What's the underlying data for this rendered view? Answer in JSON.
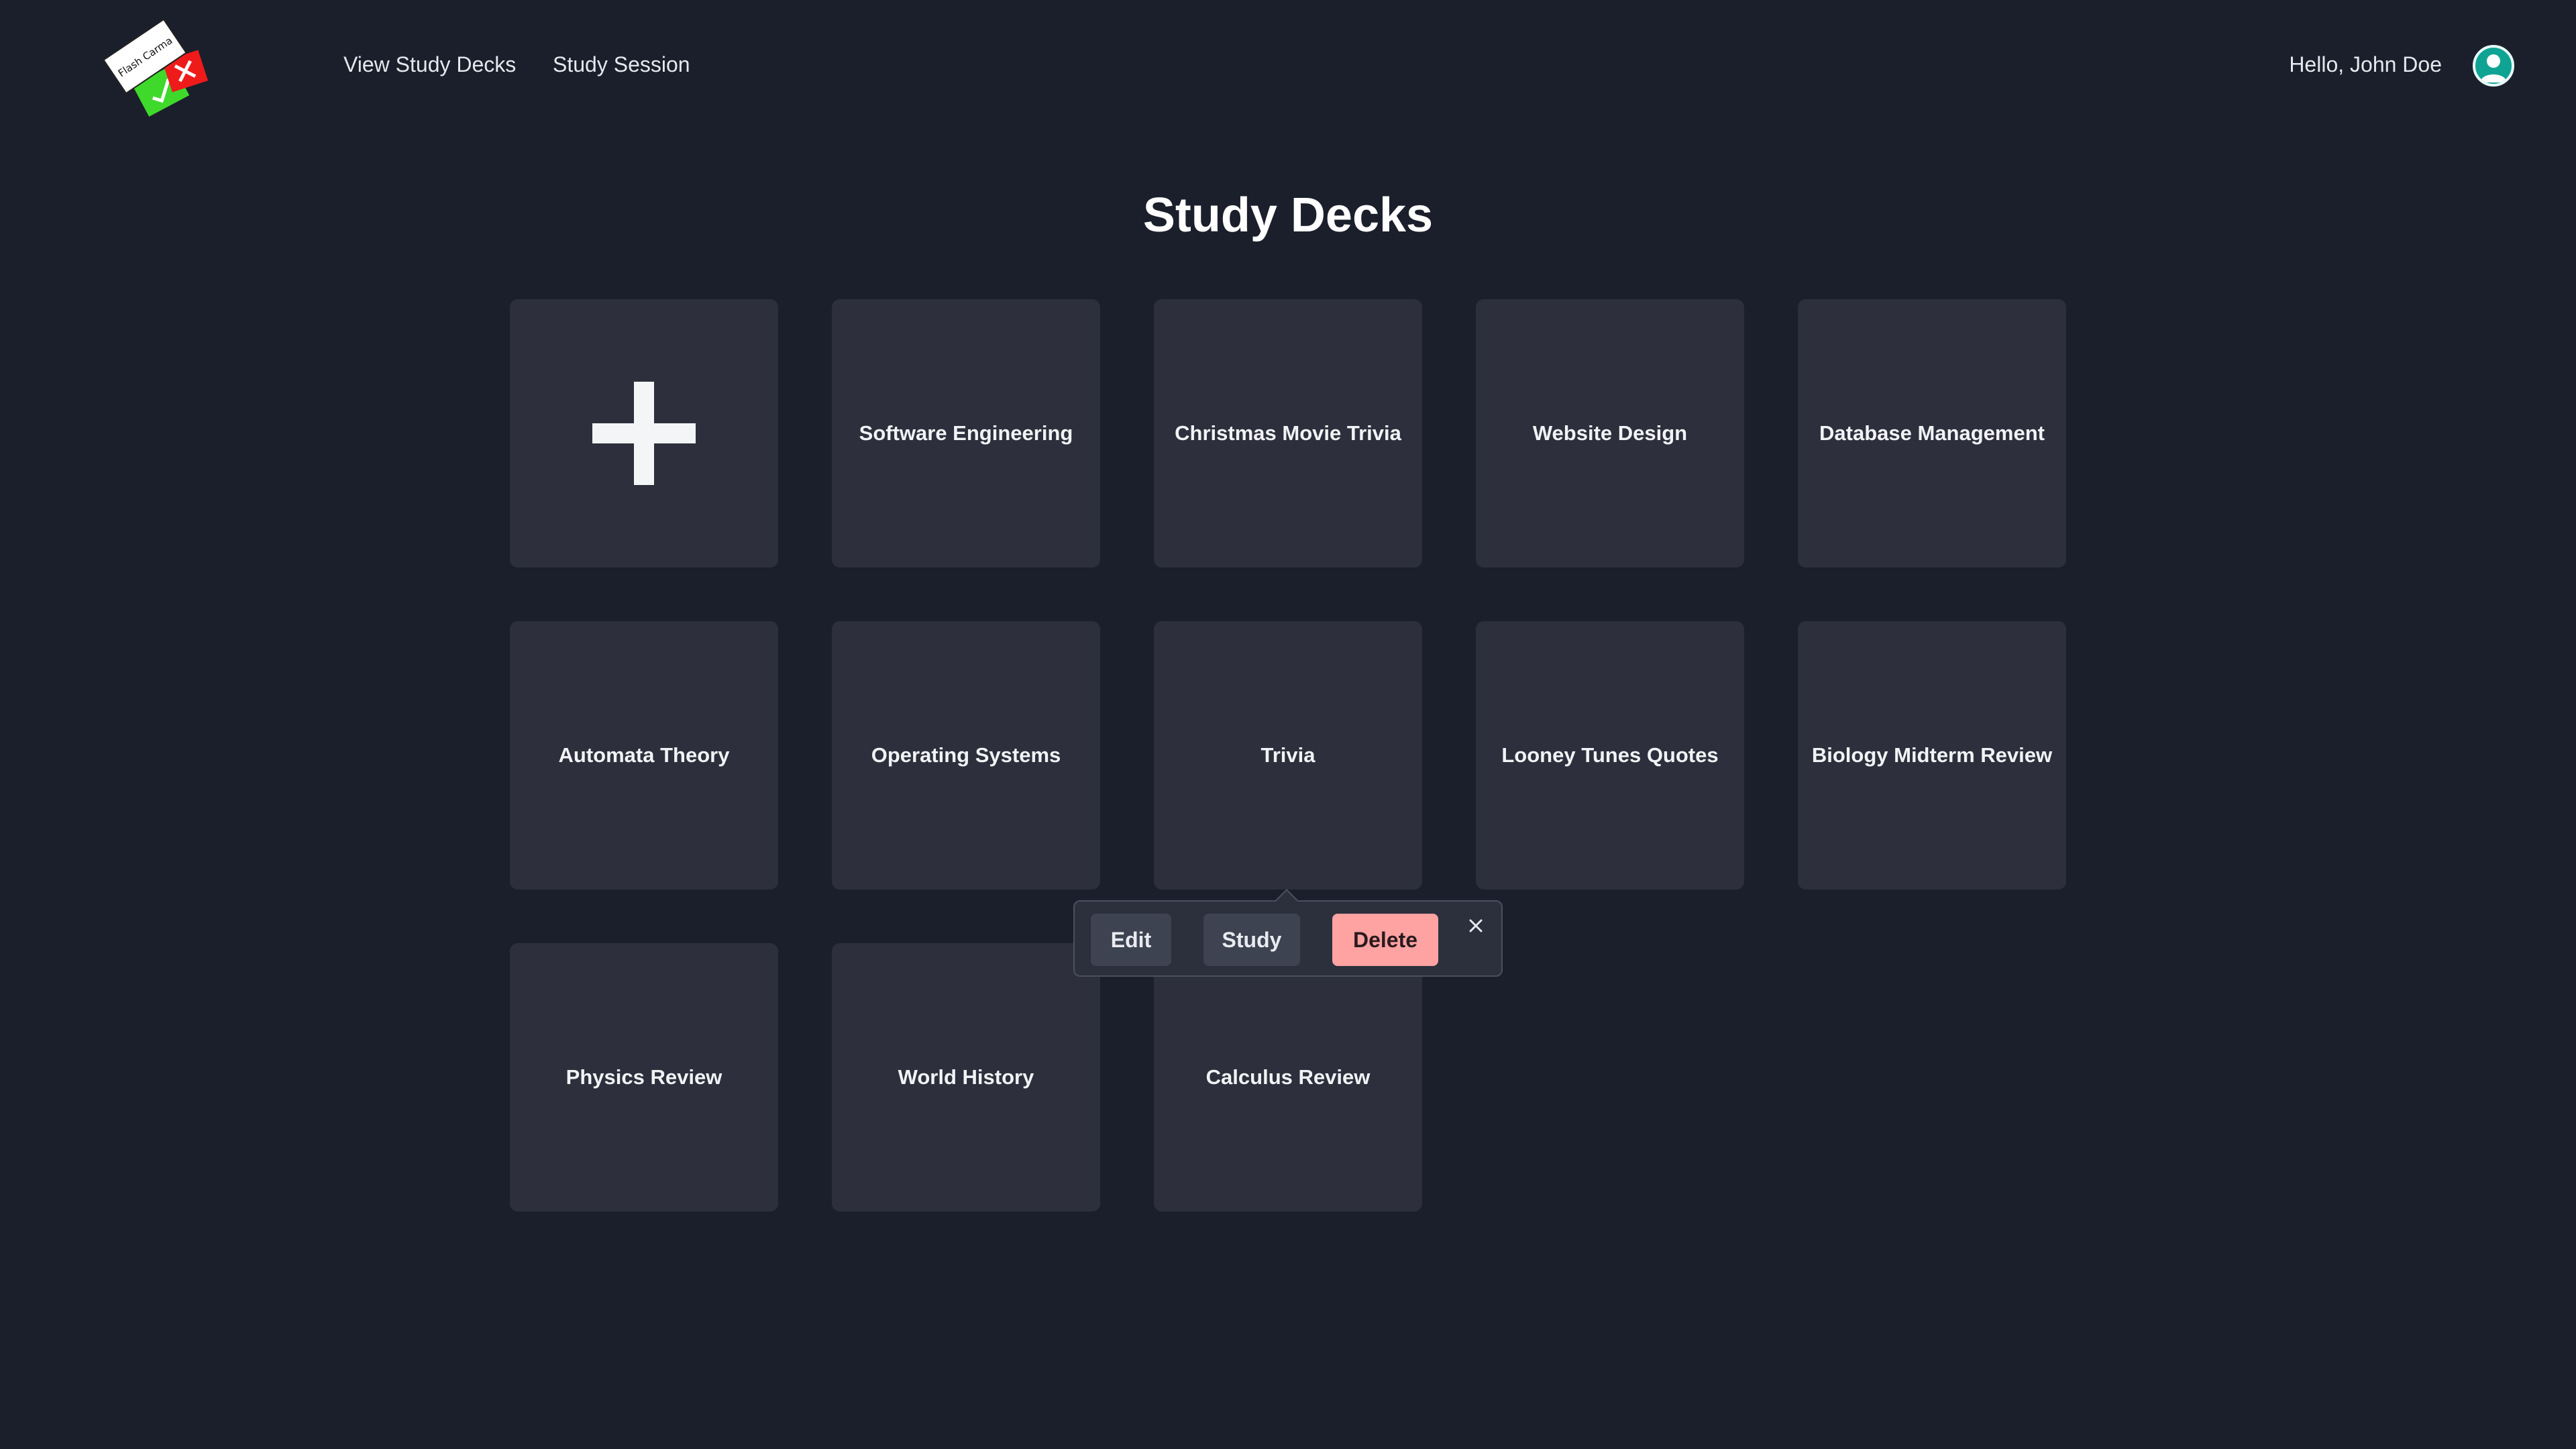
{
  "header": {
    "logo_text": "Flash Carma",
    "nav": {
      "view_decks": "View Study Decks",
      "study_session": "Study Session"
    },
    "greeting": "Hello, John Doe"
  },
  "page": {
    "title": "Study Decks"
  },
  "decks": [
    {
      "title": "Software Engineering"
    },
    {
      "title": "Christmas Movie Trivia"
    },
    {
      "title": "Website Design"
    },
    {
      "title": "Database Management"
    },
    {
      "title": "Automata Theory"
    },
    {
      "title": "Operating Systems"
    },
    {
      "title": "Trivia"
    },
    {
      "title": "Looney Tunes Quotes"
    },
    {
      "title": "Biology Midterm Review"
    },
    {
      "title": "Physics Review"
    },
    {
      "title": "World History"
    },
    {
      "title": "Calculus Review"
    }
  ],
  "popover": {
    "deck": "Trivia",
    "edit_label": "Edit",
    "study_label": "Study",
    "delete_label": "Delete"
  },
  "colors": {
    "background": "#1b1f2b",
    "card": "#2d303c",
    "delete_button": "#ffa2a2",
    "avatar": "#0fa394"
  }
}
